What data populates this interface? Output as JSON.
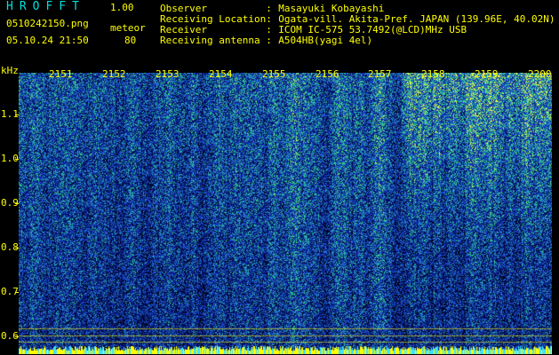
{
  "header": {
    "app_title": "HROFFT",
    "version": "1.00",
    "filename": "0510242150.png",
    "mode_label": "meteor",
    "timestamp": "05.10.24 21:50",
    "mode_value": "80"
  },
  "station_info": [
    {
      "label": "Observer",
      "value": "Masayuki Kobayashi"
    },
    {
      "label": "Receiving Location",
      "value": "Ogata-vill. Akita-Pref. JAPAN (139.96E, 40.02N)"
    },
    {
      "label": "Receiver",
      "value": "ICOM IC-575 53.7492(@LCD)MHz USB"
    },
    {
      "label": "Receiving antenna",
      "value": "A504HB(yagi 4el)"
    }
  ],
  "chart_data": {
    "type": "heatmap",
    "ylabel": "kHz",
    "y_ticks": [
      "1.1",
      "1.0",
      "0.9",
      "0.8",
      "0.7",
      "0.6"
    ],
    "x_ticks": [
      "2151",
      "2152",
      "2153",
      "2154",
      "2155",
      "2156",
      "2157",
      "2158",
      "2159",
      "2200"
    ],
    "colors": {
      "background": "#000000",
      "low": "#000a55",
      "mid": "#1c4ae0",
      "high": "#30e080",
      "peak": "#ffff40",
      "baseline": "#ffff00",
      "grid": "#ffff00"
    }
  }
}
